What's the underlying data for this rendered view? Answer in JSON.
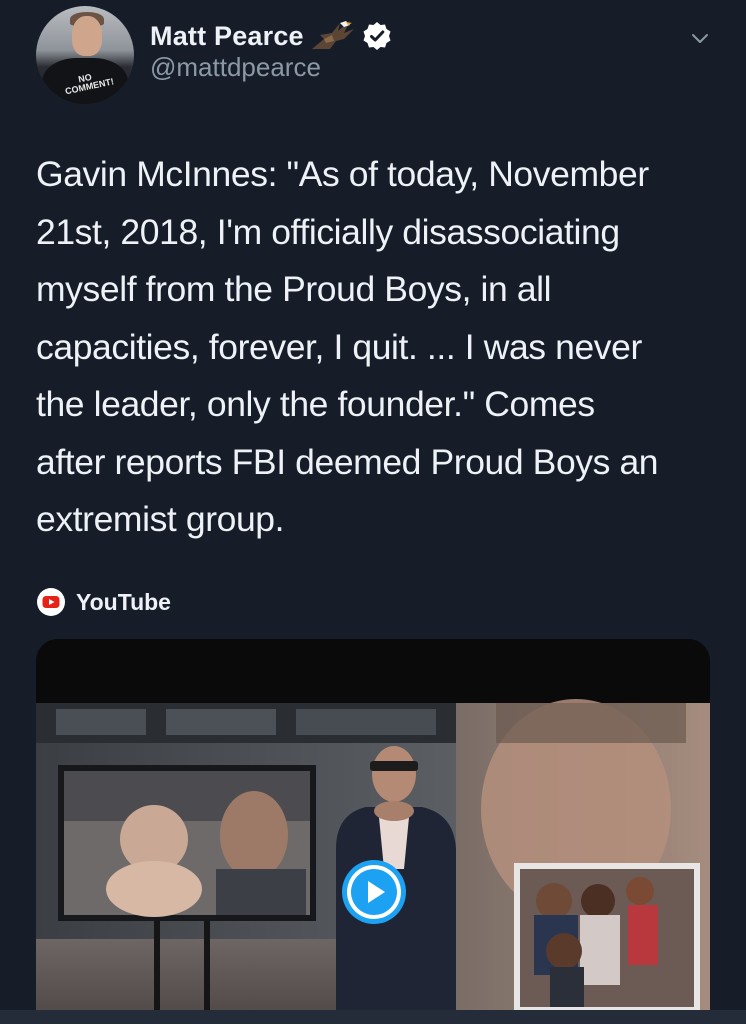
{
  "tweet": {
    "author_name": "Matt Pearce",
    "author_handle": "@mattdpearce",
    "avatar_shirt_text": "NO COMMENT!",
    "text": "Gavin McInnes: \"As of today, November\n21st, 2018, I'm officially disassociating\nmyself from the Proud Boys, in all\ncapacities, forever, I quit. ... I was never\nthe leader, only the founder.\" Comes\nafter reports FBI deemed Proud Boys an\nextremist group.",
    "source_label": "YouTube"
  },
  "icons": {
    "verified": "verified-badge-icon",
    "eagle": "eagle-emoji-icon",
    "menu": "chevron-down-icon",
    "source": "youtube-icon",
    "play": "play-icon"
  },
  "colors": {
    "background": "#161d29",
    "text": "#eef2f7",
    "secondary_text": "#8b98a5",
    "accent": "#1da1f2",
    "youtube_red": "#e62117"
  }
}
